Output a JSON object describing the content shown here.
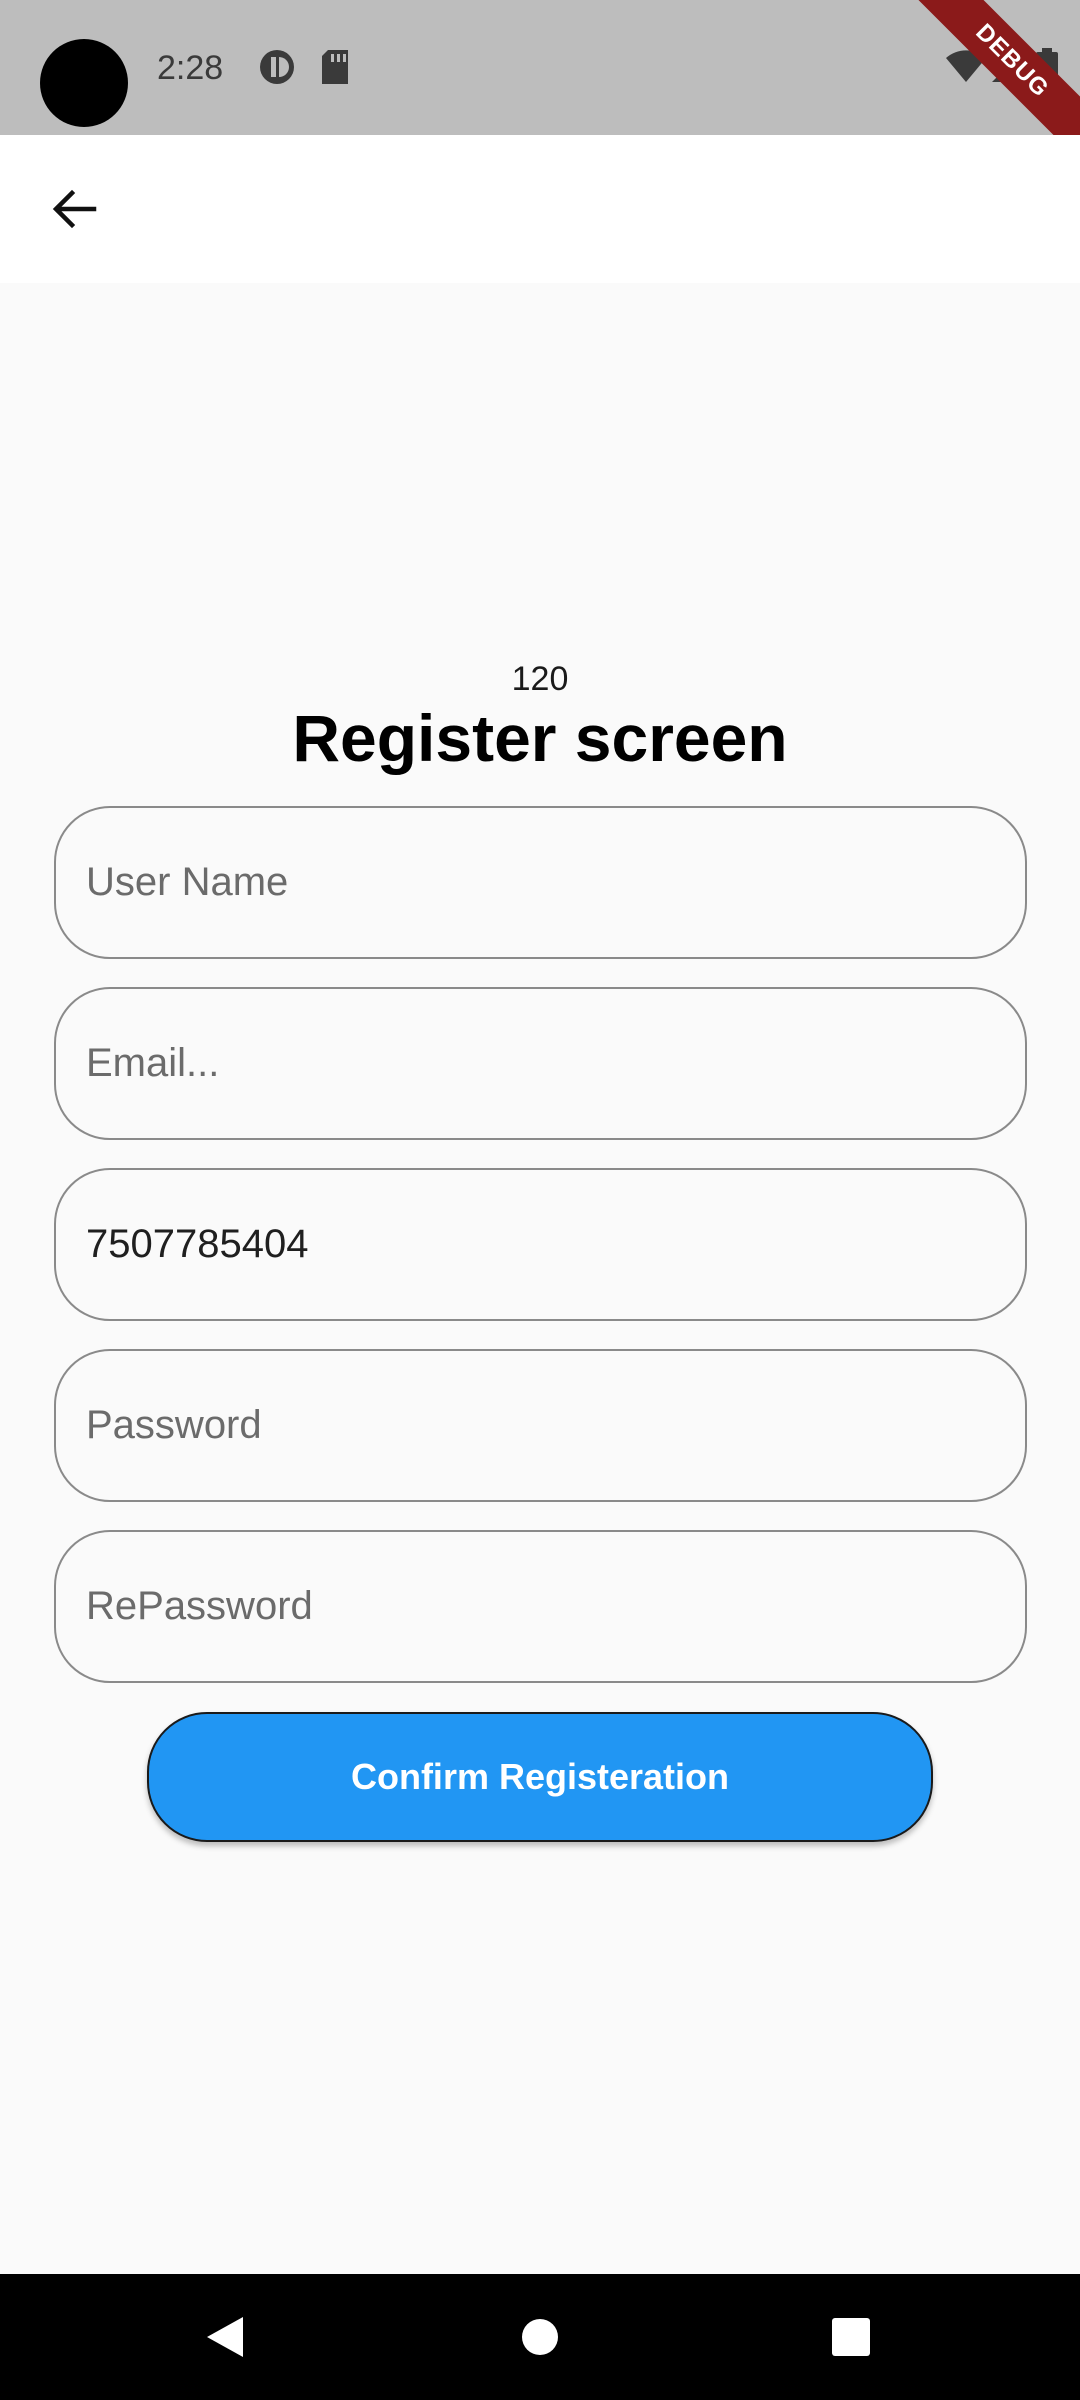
{
  "status_bar": {
    "time": "2:28",
    "debug_label": "DEBUG"
  },
  "app_bar": {
    "back_icon": "arrow-back-icon"
  },
  "main": {
    "counter": "120",
    "title": "Register screen",
    "fields": {
      "username": {
        "placeholder": "User Name",
        "value": ""
      },
      "email": {
        "placeholder": "Email...",
        "value": ""
      },
      "phone": {
        "placeholder": "",
        "value": "7507785404"
      },
      "password": {
        "placeholder": "Password",
        "value": ""
      },
      "repassword": {
        "placeholder": "RePassword",
        "value": ""
      }
    },
    "confirm_label": "Confirm Registeration"
  },
  "nav_bar": {
    "icons": [
      "back-triangle-icon",
      "home-circle-icon",
      "recents-square-icon"
    ]
  },
  "colors": {
    "accent": "#2196f3",
    "background": "#fafafa",
    "status_bar": "#bdbdbd",
    "debug_ribbon": "#8b1a1a"
  }
}
